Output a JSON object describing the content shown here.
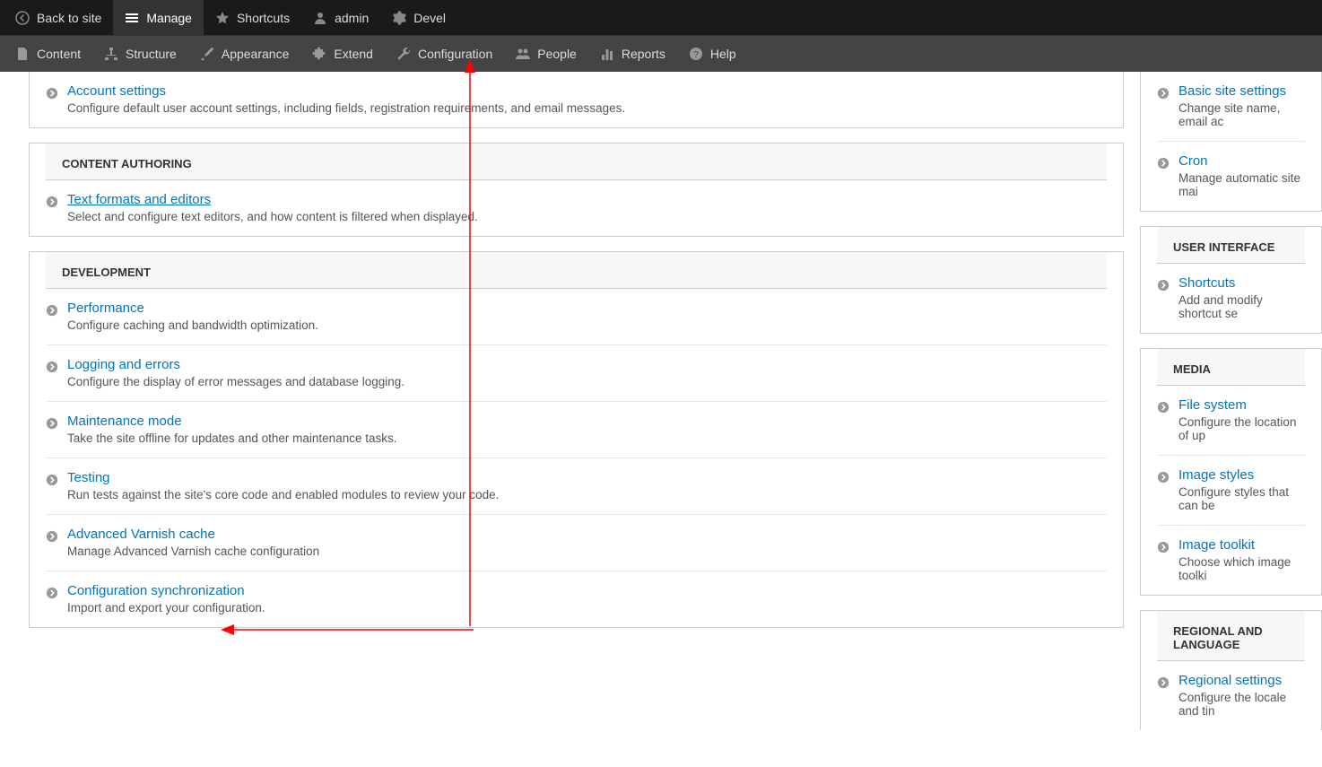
{
  "topbar": {
    "back": "Back to site",
    "manage": "Manage",
    "shortcuts": "Shortcuts",
    "admin": "admin",
    "devel": "Devel"
  },
  "navbar": {
    "content": "Content",
    "structure": "Structure",
    "appearance": "Appearance",
    "extend": "Extend",
    "configuration": "Configuration",
    "people": "People",
    "reports": "Reports",
    "help": "Help"
  },
  "main": [
    {
      "header": null,
      "items": [
        {
          "label": "Account settings",
          "desc": "Configure default user account settings, including fields, registration requirements, and email messages."
        }
      ]
    },
    {
      "header": "CONTENT AUTHORING",
      "items": [
        {
          "label": "Text formats and editors",
          "desc": "Select and configure text editors, and how content is filtered when displayed.",
          "underline": true
        }
      ]
    },
    {
      "header": "DEVELOPMENT",
      "items": [
        {
          "label": "Performance",
          "desc": "Configure caching and bandwidth optimization."
        },
        {
          "label": "Logging and errors",
          "desc": "Configure the display of error messages and database logging."
        },
        {
          "label": "Maintenance mode",
          "desc": "Take the site offline for updates and other maintenance tasks."
        },
        {
          "label": "Testing",
          "desc": "Run tests against the site's core code and enabled modules to review your code."
        },
        {
          "label": "Advanced Varnish cache",
          "desc": "Manage Advanced Varnish cache configuration"
        },
        {
          "label": "Configuration synchronization",
          "desc": "Import and export your configuration."
        }
      ]
    }
  ],
  "side": [
    {
      "header": null,
      "items": [
        {
          "label": "Basic site settings",
          "desc": "Change site name, email ac"
        },
        {
          "label": "Cron",
          "desc": "Manage automatic site mai"
        }
      ]
    },
    {
      "header": "USER INTERFACE",
      "items": [
        {
          "label": "Shortcuts",
          "desc": "Add and modify shortcut se"
        }
      ]
    },
    {
      "header": "MEDIA",
      "items": [
        {
          "label": "File system",
          "desc": "Configure the location of up"
        },
        {
          "label": "Image styles",
          "desc": "Configure styles that can be"
        },
        {
          "label": "Image toolkit",
          "desc": "Choose which image toolki"
        }
      ]
    },
    {
      "header": "REGIONAL AND LANGUAGE",
      "items": [
        {
          "label": "Regional settings",
          "desc": "Configure the locale and tin"
        }
      ]
    }
  ]
}
